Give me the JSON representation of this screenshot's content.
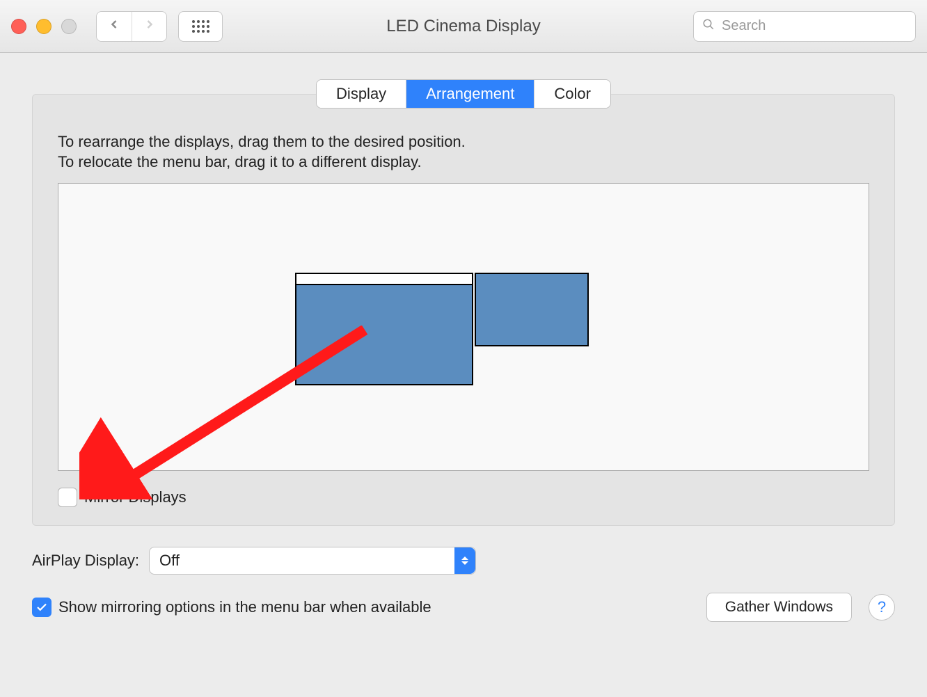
{
  "window": {
    "title": "LED Cinema Display",
    "search_placeholder": "Search"
  },
  "tabs": {
    "display": "Display",
    "arrangement": "Arrangement",
    "color": "Color"
  },
  "instructions": {
    "line1": "To rearrange the displays, drag them to the desired position.",
    "line2": "To relocate the menu bar, drag it to a different display."
  },
  "mirror": {
    "label": "Mirror Displays",
    "checked": false
  },
  "airplay": {
    "label": "AirPlay Display:",
    "value": "Off"
  },
  "show_mirroring": {
    "label": "Show mirroring options in the menu bar when available",
    "checked": true
  },
  "gather_windows_label": "Gather Windows",
  "help_label": "?"
}
